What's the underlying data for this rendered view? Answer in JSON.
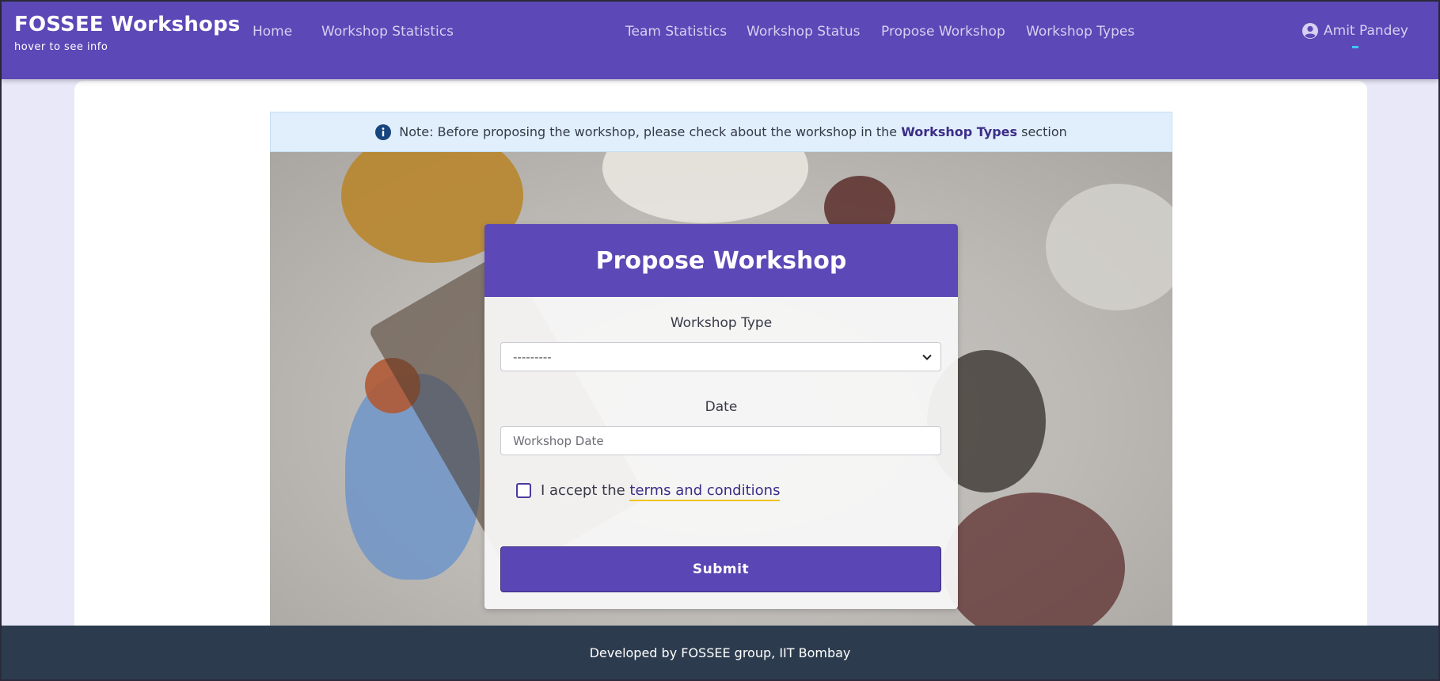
{
  "navbar": {
    "brand_title": "FOSSEE Workshops",
    "brand_subtitle": "hover to see info",
    "links": [
      {
        "label": "Home"
      },
      {
        "label": "Workshop Statistics"
      },
      {
        "label": "Team Statistics"
      },
      {
        "label": "Workshop Status"
      },
      {
        "label": "Propose Workshop"
      },
      {
        "label": "Workshop Types"
      }
    ],
    "user_name": "Amit Pandey",
    "user_icon": "user-circle-icon"
  },
  "note": {
    "icon": "info-icon",
    "text_before": "Note: Before proposing the workshop, please check about the workshop in the",
    "bold_text": "Workshop Types",
    "text_after": "section"
  },
  "form": {
    "title": "Propose Workshop",
    "workshop_type_label": "Workshop Type",
    "workshop_type_value": "---------",
    "date_label": "Date",
    "date_placeholder": "Workshop Date",
    "accept_text": "I accept the",
    "terms_link": "terms and conditions",
    "submit_label": "Submit"
  },
  "footer": {
    "text": "Developed by FOSSEE group, IIT Bombay"
  },
  "colors": {
    "navbar": "#5c48b6",
    "footer": "#2c3c4e",
    "accent_underline": "#f0c419",
    "note_bg": "#e1effc"
  }
}
